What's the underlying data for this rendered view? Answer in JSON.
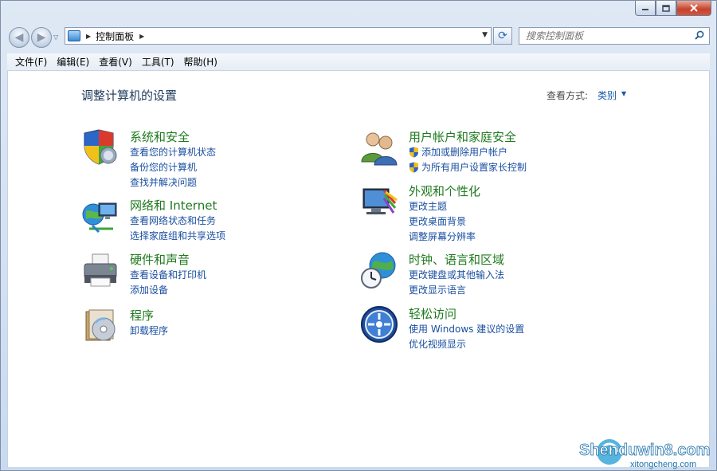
{
  "address": {
    "crumb": "控制面板"
  },
  "search": {
    "placeholder": "搜索控制面板"
  },
  "menu": [
    "文件(F)",
    "编辑(E)",
    "查看(V)",
    "工具(T)",
    "帮助(H)"
  ],
  "page": {
    "title": "调整计算机的设置",
    "view_label": "查看方式:",
    "view_value": "类别"
  },
  "categories": [
    {
      "title": "系统和安全",
      "icon": "shield-pc-icon",
      "links": [
        "查看您的计算机状态",
        "备份您的计算机",
        "查找并解决问题"
      ]
    },
    {
      "title": "网络和 Internet",
      "icon": "network-globe-icon",
      "links": [
        "查看网络状态和任务",
        "选择家庭组和共享选项"
      ]
    },
    {
      "title": "硬件和声音",
      "icon": "printer-icon",
      "links": [
        "查看设备和打印机",
        "添加设备"
      ]
    },
    {
      "title": "程序",
      "icon": "programs-disc-icon",
      "links": [
        "卸载程序"
      ]
    },
    {
      "title": "用户帐户和家庭安全",
      "icon": "users-icon",
      "links": [
        "添加或删除用户帐户",
        "为所有用户设置家长控制"
      ]
    },
    {
      "title": "外观和个性化",
      "icon": "monitor-palette-icon",
      "links": [
        "更改主题",
        "更改桌面背景",
        "调整屏幕分辨率"
      ]
    },
    {
      "title": "时钟、语言和区域",
      "icon": "clock-globe-icon",
      "links": [
        "更改键盘或其他输入法",
        "更改显示语言"
      ]
    },
    {
      "title": "轻松访问",
      "icon": "ease-of-access-icon",
      "links": [
        "使用 Windows 建议的设置",
        "优化视频显示"
      ]
    }
  ],
  "watermark": {
    "main": "Shenduwin8.com",
    "sub": "xitongcheng.com"
  },
  "colors": {
    "link": "#1a4fa0",
    "category_title": "#1f7a1f",
    "title": "#1e395b"
  }
}
